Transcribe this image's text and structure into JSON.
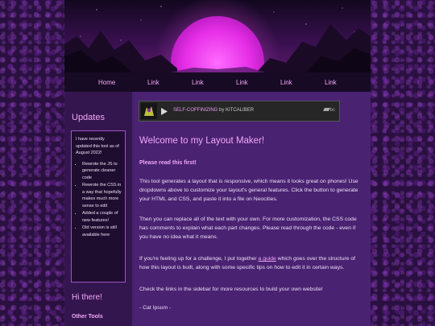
{
  "nav": {
    "items": [
      {
        "label": "Home"
      },
      {
        "label": "Link"
      },
      {
        "label": "Link"
      },
      {
        "label": "Link"
      },
      {
        "label": "Link"
      },
      {
        "label": "Link"
      }
    ]
  },
  "sidebar": {
    "title": "Updates",
    "updates_intro": "I have recently updated this tool as of August 2022!",
    "updates": [
      "Rewrote the JS to generate cleaner code",
      "Rewrote the CSS in a way that hopefully makes much more sense to edit",
      "Added a couple of new features!",
      "Old version is still available here"
    ],
    "hi_heading": "Hi there!",
    "other_tools": "Other Tools"
  },
  "player": {
    "track_title": "SELF-COFFINIZING",
    "by_text": " by KITCALIBER",
    "service_label": "bc"
  },
  "main": {
    "title": "Welcome to my Layout Maker!",
    "read_first": "Please read this first!",
    "p1": "This tool generates a layout that is responsive, which means it looks great on phones! Use dropdowns above to customize your layout's general features. Click the button to generate your HTML and CSS, and paste it into a file on Neocities.",
    "p2": "Then you can replace all of the text with your own. For more customization, the CSS code has comments to explain what each part changes. Please read through the code - even if you have no idea what it means.",
    "p3_before": "If you're feeling up for a challenge, I put together ",
    "p3_link": "a guide",
    "p3_after": " which goes over the structure of how this layout is built, along with some specific tips on how to edit it in certain ways.",
    "p4": "Check the links in the sidebar for more resources to build your own website!",
    "signature": "- Cat Ipsum -"
  },
  "colors": {
    "accent": "#f0a8f5",
    "sun": "#e62ee6",
    "nav_bg": "#170a24",
    "sidebar_bg": "#34164f",
    "main_bg": "#4a2272"
  }
}
